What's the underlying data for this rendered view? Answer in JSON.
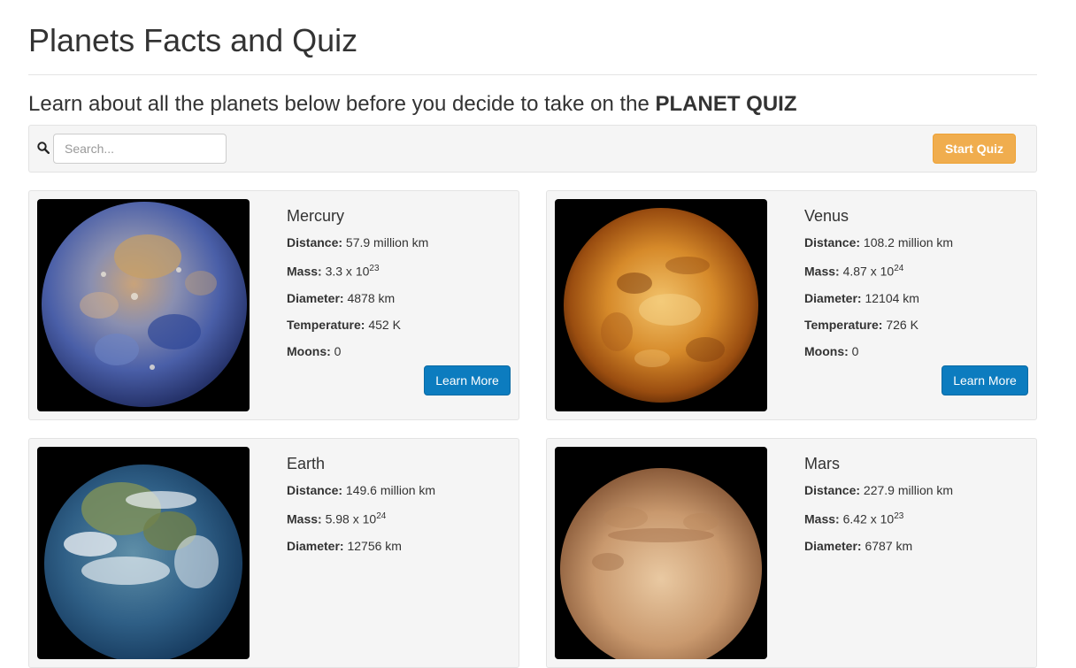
{
  "page": {
    "title": "Planets Facts and Quiz",
    "subtitle_text": "Learn about all the planets below before you decide to take on the",
    "subtitle_bold": "PLANET QUIZ"
  },
  "toolbar": {
    "search_icon": "search-icon",
    "search_placeholder": "Search...",
    "search_value": "",
    "start_quiz_label": "Start Quiz"
  },
  "labels": {
    "distance": "Distance:",
    "mass": "Mass:",
    "diameter": "Diameter:",
    "temperature": "Temperature:",
    "moons": "Moons:",
    "learn_more": "Learn More"
  },
  "planets": [
    {
      "name": "Mercury",
      "distance": "57.9 million km",
      "mass_base": "3.3 x 10",
      "mass_exp": "23",
      "diameter": "4878 km",
      "temperature": "452 K",
      "moons": "0"
    },
    {
      "name": "Venus",
      "distance": "108.2 million km",
      "mass_base": "4.87 x 10",
      "mass_exp": "24",
      "diameter": "12104 km",
      "temperature": "726 K",
      "moons": "0"
    },
    {
      "name": "Earth",
      "distance": "149.6 million km",
      "mass_base": "5.98 x 10",
      "mass_exp": "24",
      "diameter": "12756 km"
    },
    {
      "name": "Mars",
      "distance": "227.9 million km",
      "mass_base": "6.42 x 10",
      "mass_exp": "23",
      "diameter": "6787 km"
    }
  ],
  "colors": {
    "start_quiz": "#f0ad4e",
    "learn_more": "#0c7cbf",
    "card_bg": "#f5f5f5"
  }
}
